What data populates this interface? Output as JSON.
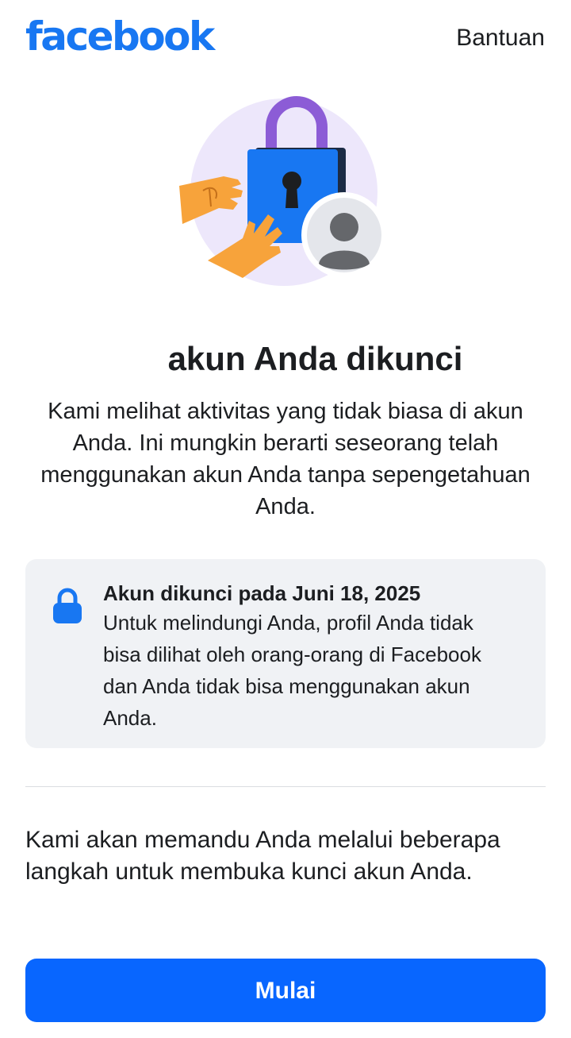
{
  "header": {
    "logo_text": "facebook",
    "help_label": "Bantuan"
  },
  "hero": {
    "illustration_icon": "locked-account-illustration"
  },
  "main": {
    "title": "akun Anda dikunci",
    "description": "Kami melihat aktivitas yang tidak biasa di akun Anda. Ini mungkin berarti seseorang telah menggunakan akun Anda tanpa sepengetahuan Anda."
  },
  "info_card": {
    "icon": "lock-icon",
    "title": "Akun dikunci pada Juni 18, 2025",
    "body": "Untuk melindungi Anda, profil Anda tidak bisa dilihat oleh orang-orang di Facebook dan Anda tidak bisa menggunakan akun Anda."
  },
  "guide": {
    "text": "Kami akan memandu Anda melalui beberapa langkah untuk membuka kunci akun Anda."
  },
  "actions": {
    "start_label": "Mulai"
  },
  "colors": {
    "brand": "#1877f2",
    "button": "#0866ff",
    "card_bg": "#f0f2f5",
    "lock_purple": "#8c5cd6",
    "hand_orange": "#f7a33b"
  }
}
